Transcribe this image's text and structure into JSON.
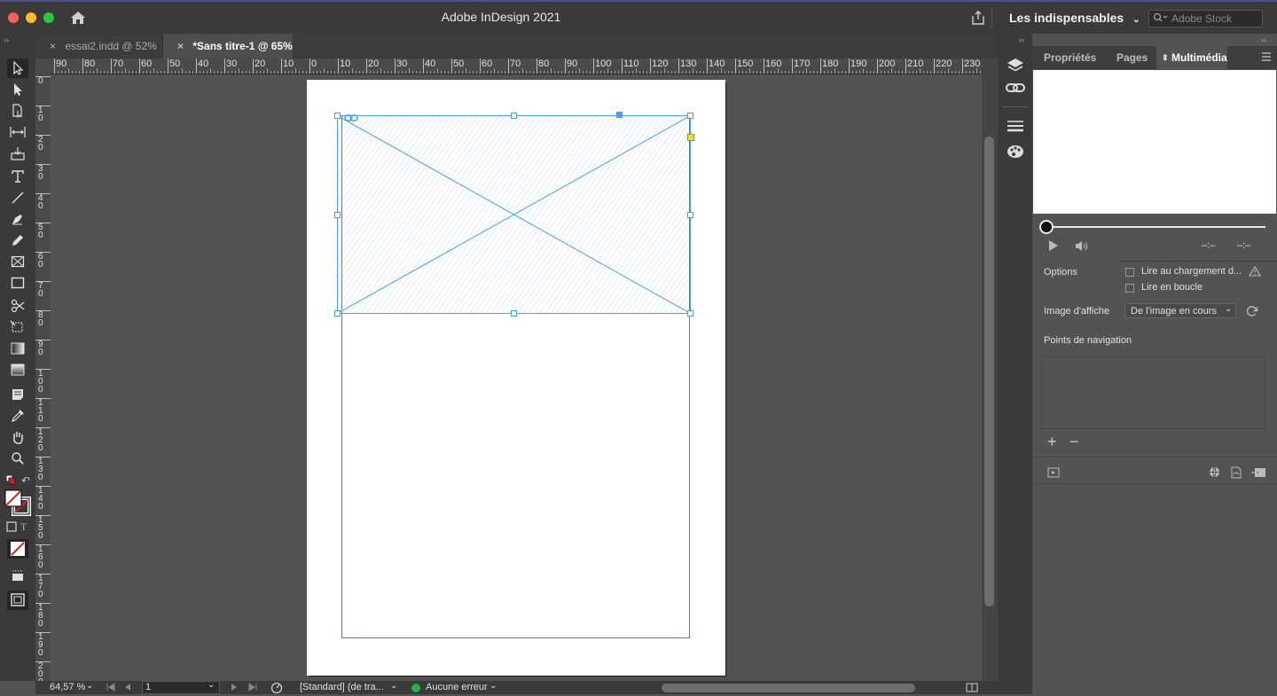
{
  "window": {
    "title": "Adobe InDesign 2021",
    "workspace": "Les indispensables",
    "stock_placeholder": "Adobe Stock"
  },
  "tabs": [
    {
      "label": "essai2.indd @ 52%",
      "active": false
    },
    {
      "label": "*Sans titre-1 @ 65%",
      "active": true
    }
  ],
  "ruler": {
    "h_labels": [
      "90",
      "80",
      "70",
      "60",
      "50",
      "40",
      "30",
      "20",
      "10",
      "0",
      "10",
      "20",
      "30",
      "40",
      "50",
      "60",
      "70",
      "80",
      "90",
      "100",
      "110",
      "120",
      "130",
      "140",
      "150",
      "160",
      "170",
      "180",
      "190",
      "200",
      "210",
      "220",
      "230"
    ],
    "v_labels": [
      "0",
      "10",
      "20",
      "30",
      "40",
      "50",
      "60",
      "70",
      "80",
      "90",
      "100",
      "110",
      "120",
      "130",
      "140",
      "150",
      "160",
      "170",
      "180",
      "190",
      "200"
    ]
  },
  "panel": {
    "tabs": [
      "Propriétés",
      "Pages",
      "Multimédia"
    ],
    "active_tab": "Multimédia",
    "time_current": "–:–",
    "time_total": "–:–",
    "options_label": "Options",
    "opt_autoplay": "Lire au chargement d...",
    "opt_loop": "Lire en boucle",
    "poster_label": "Image d'affiche",
    "poster_value": "De l'image en cours",
    "nav_points_label": "Points de navigation",
    "add_symbol": "+",
    "remove_symbol": "−"
  },
  "status": {
    "zoom": "64,57 %",
    "page": "1",
    "preflight_profile": "[Standard] (de tra...",
    "errors": "Aucune erreur",
    "error_color": "#1fb141"
  },
  "colors": {
    "frame_blue": "#4a9ce6",
    "margin_magenta": "#c33ac3",
    "tab_accent": "#4c4aa6"
  },
  "icons": [
    "home-icon",
    "share-icon",
    "search-icon",
    "chevron-down-icon",
    "selection-tool-icon",
    "direct-selection-tool-icon",
    "page-tool-icon",
    "gap-tool-icon",
    "content-collector-icon",
    "type-tool-icon",
    "line-tool-icon",
    "pen-tool-icon",
    "pencil-tool-icon",
    "rectangle-frame-tool-icon",
    "rectangle-tool-icon",
    "scissors-tool-icon",
    "free-transform-tool-icon",
    "gradient-swatch-tool-icon",
    "gradient-feather-tool-icon",
    "note-tool-icon",
    "eyedropper-tool-icon",
    "hand-tool-icon",
    "zoom-tool-icon",
    "layers-icon",
    "links-icon",
    "stroke-icon",
    "swatches-icon",
    "play-icon",
    "volume-icon",
    "warning-icon",
    "refresh-icon",
    "panel-menu-icon"
  ]
}
